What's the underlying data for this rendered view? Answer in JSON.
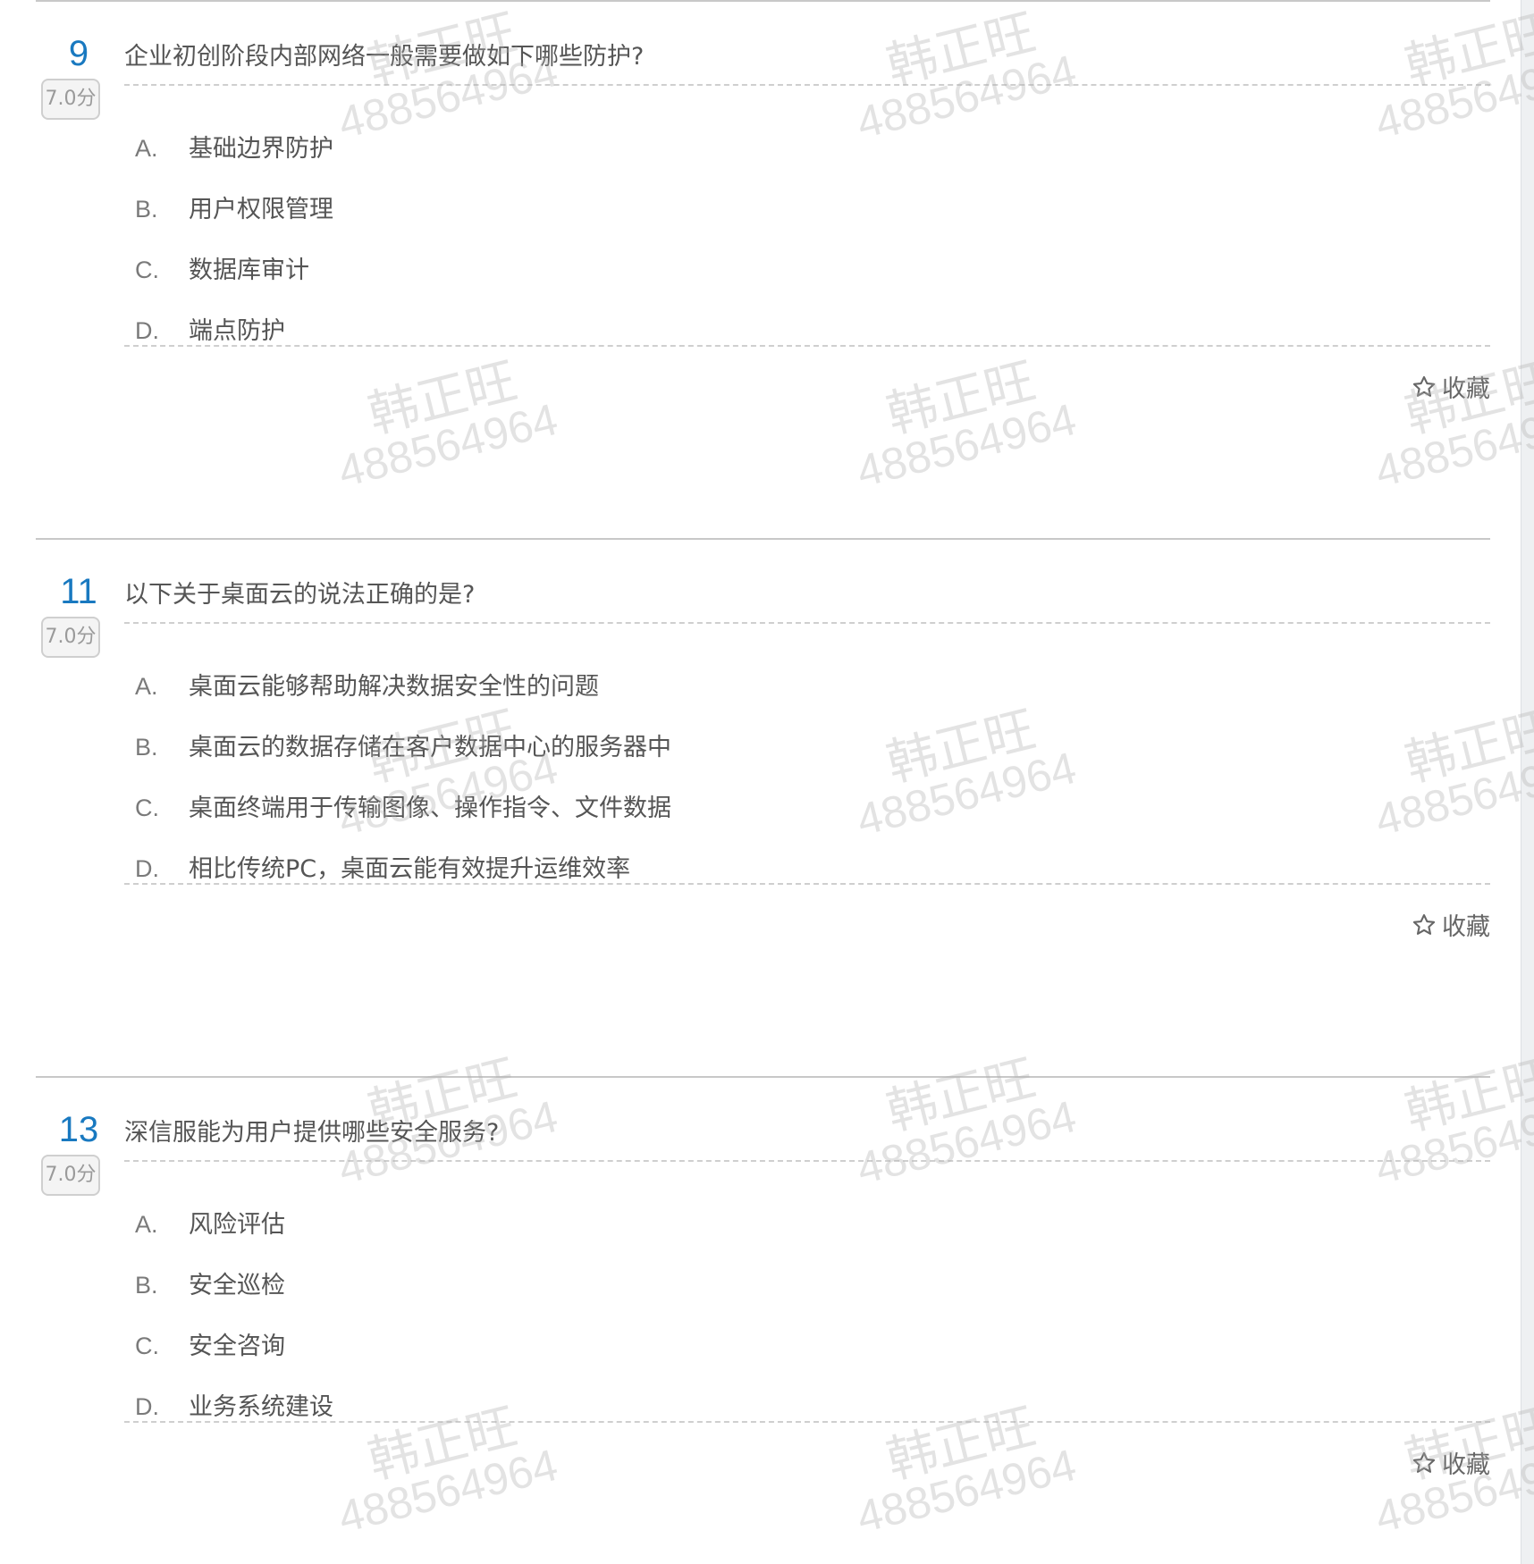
{
  "questions": [
    {
      "number": "9",
      "score": "7.0分",
      "title": "企业初创阶段内部网络一般需要做如下哪些防护?",
      "options": [
        {
          "key": "A.",
          "text": "基础边界防护"
        },
        {
          "key": "B.",
          "text": "用户权限管理"
        },
        {
          "key": "C.",
          "text": "数据库审计"
        },
        {
          "key": "D.",
          "text": "端点防护"
        }
      ],
      "favorite_icon": "star-outline-icon",
      "favorite_label": "收藏"
    },
    {
      "number": "11",
      "score": "7.0分",
      "title": "以下关于桌面云的说法正确的是?",
      "options": [
        {
          "key": "A.",
          "text": "桌面云能够帮助解决数据安全性的问题"
        },
        {
          "key": "B.",
          "text": "桌面云的数据存储在客户数据中心的服务器中"
        },
        {
          "key": "C.",
          "text": "桌面终端用于传输图像、操作指令、文件数据"
        },
        {
          "key": "D.",
          "text": "相比传统PC，桌面云能有效提升运维效率"
        }
      ],
      "favorite_icon": "star-outline-icon",
      "favorite_label": "收藏"
    },
    {
      "number": "13",
      "score": "7.0分",
      "title": "深信服能为用户提供哪些安全服务?",
      "options": [
        {
          "key": "A.",
          "text": "风险评估"
        },
        {
          "key": "B.",
          "text": "安全巡检"
        },
        {
          "key": "C.",
          "text": "安全咨询"
        },
        {
          "key": "D.",
          "text": "业务系统建设"
        }
      ],
      "favorite_icon": "star-outline-icon",
      "favorite_label": "收藏"
    }
  ],
  "watermark": {
    "name": "韩正旺",
    "id": "488564964"
  },
  "colors": {
    "number": "#1979c0",
    "text": "#555555",
    "option_key": "#7a7a7a",
    "border": "#cfcfcf",
    "watermark": "#afafaf"
  }
}
